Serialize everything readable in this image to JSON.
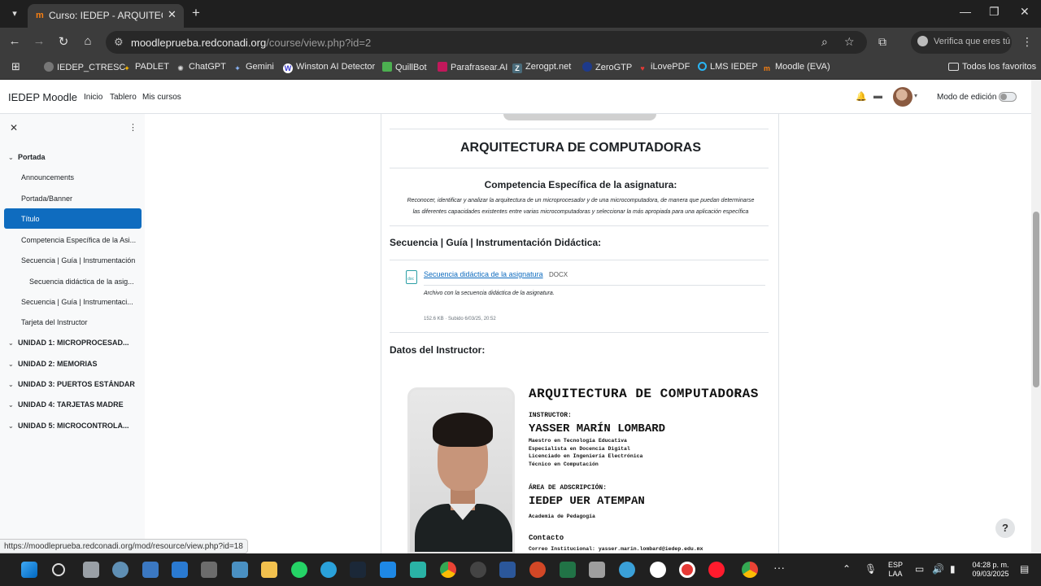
{
  "browser": {
    "tab_title": "Curso: IEDEP - ARQUITECTURA",
    "url_host": "moodleprueba.redconadi.org",
    "url_path": "/course/view.php?id=2",
    "verify_label": "Verifica que eres tú",
    "status_url": "https://moodleprueba.redconadi.org/mod/resource/view.php?id=18",
    "bookmarks": [
      "IEDEP_CTRESC",
      "PADLET",
      "ChatGPT",
      "Gemini",
      "Winston AI Detector",
      "QuillBot",
      "Parafrasear.AI",
      "Zerogpt.net",
      "ZeroGTP",
      "iLovePDF",
      "LMS IEDEP",
      "Moodle (EVA)"
    ],
    "all_bookmarks": "Todos los favoritos"
  },
  "moodle": {
    "brand": "IEDEP Moodle",
    "nav": [
      "Inicio",
      "Tablero",
      "Mis cursos"
    ],
    "edit_mode_label": "Modo de edición"
  },
  "course_index": {
    "portada": "Portada",
    "items": [
      "Announcements",
      "Portada/Banner",
      "Título",
      "Competencia Específica de la Asi...",
      "Secuencia | Guía | Instrumentación",
      "Secuencia didáctica de la asig...",
      "Secuencia | Guía | Instrumentaci...",
      "Tarjeta del Instructor"
    ],
    "sections": [
      "UNIDAD 1: MICROPROCESAD...",
      "UNIDAD 2: MEMORIAS",
      "UNIDAD 3: PUERTOS ESTÁNDAR",
      "UNIDAD 4: TARJETAS MADRE",
      "UNIDAD 5: MICROCONTROLA..."
    ]
  },
  "content": {
    "course_title": "ARQUITECTURA DE COMPUTADORAS",
    "competencia_title": "Competencia Específica de la asignatura:",
    "competencia_line1": "Reconocer, identificar y analizar la arquitectura de un microprocesador y de una microcomputadora, de manera que puedan determinarse",
    "competencia_line2": "las diferentes capacidades existentes entre varias microcomputadoras y seleccionar la más apropiada para una aplicación específica",
    "secuencia_title": "Secuencia | Guía | Instrumentación Didáctica:",
    "resource_link": "Secuencia didáctica de la asignatura",
    "resource_type": "DOCX",
    "resource_desc": "Archivo con la secuencia didáctica de la asignatura.",
    "resource_meta": "152.6 KB · Subido 6/03/25, 20:52",
    "datos_title": "Datos del Instructor:"
  },
  "instructor_card": {
    "title": "ARQUITECTURA DE COMPUTADORAS",
    "instructor_label": "INSTRUCTOR:",
    "name": "YASSER MARÍN LOMBARD",
    "credentials": [
      "Maestro en Tecnología Educativa",
      "Especialista en Docencia Digital",
      "Licenciado en Ingeniería Electrónica",
      "Técnico en Computación"
    ],
    "area_label": "ÁREA DE ADSCRIPCIÓN:",
    "area": "IEDEP UER ATEMPAN",
    "area_sub": "Academia de Pedagogía",
    "contact_label": "Contacto",
    "contact_email": "Correo Institucional: yasser.marin.lombard@iedep.edu.mx"
  },
  "taskbar": {
    "lang": "ESP",
    "lang2": "LAA",
    "time": "04:28 p. m.",
    "date": "09/03/2025"
  },
  "icons": {
    "help": "?"
  },
  "colors": {
    "moodle_blue": "#0f6cbf",
    "chrome_dark": "#3c3c3c"
  }
}
